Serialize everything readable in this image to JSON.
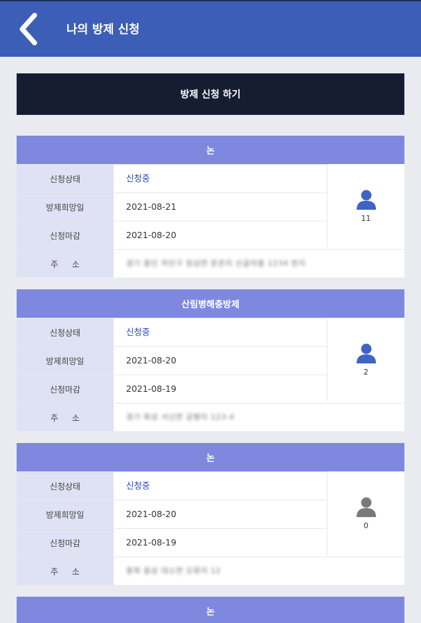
{
  "header": {
    "title": "나의 방제 신청"
  },
  "apply_button": {
    "label": "방제 신청 하기"
  },
  "labels": {
    "status": "신청상태",
    "desired_date": "방제희망일",
    "deadline": "신청마감",
    "address": "주 소"
  },
  "cards": [
    {
      "title": "논",
      "status": "신청중",
      "desired_date": "2021-08-21",
      "deadline": "2021-08-20",
      "address": "경기 용인 처인구 원삼면 문촌리 산골마을 1234 번지",
      "count": "11",
      "person_color": "#3f63c6"
    },
    {
      "title": "산림병해충방제",
      "status": "신청중",
      "desired_date": "2021-08-20",
      "deadline": "2021-08-19",
      "address": "경기 화성 서신면 궁평리 123-4",
      "count": "2",
      "person_color": "#3f63c6"
    },
    {
      "title": "논",
      "status": "신청중",
      "desired_date": "2021-08-20",
      "deadline": "2021-08-19",
      "address": "충북 음성 대소면 오류리 12",
      "count": "0",
      "person_color": "#7a7a7a"
    },
    {
      "title": "논"
    }
  ]
}
